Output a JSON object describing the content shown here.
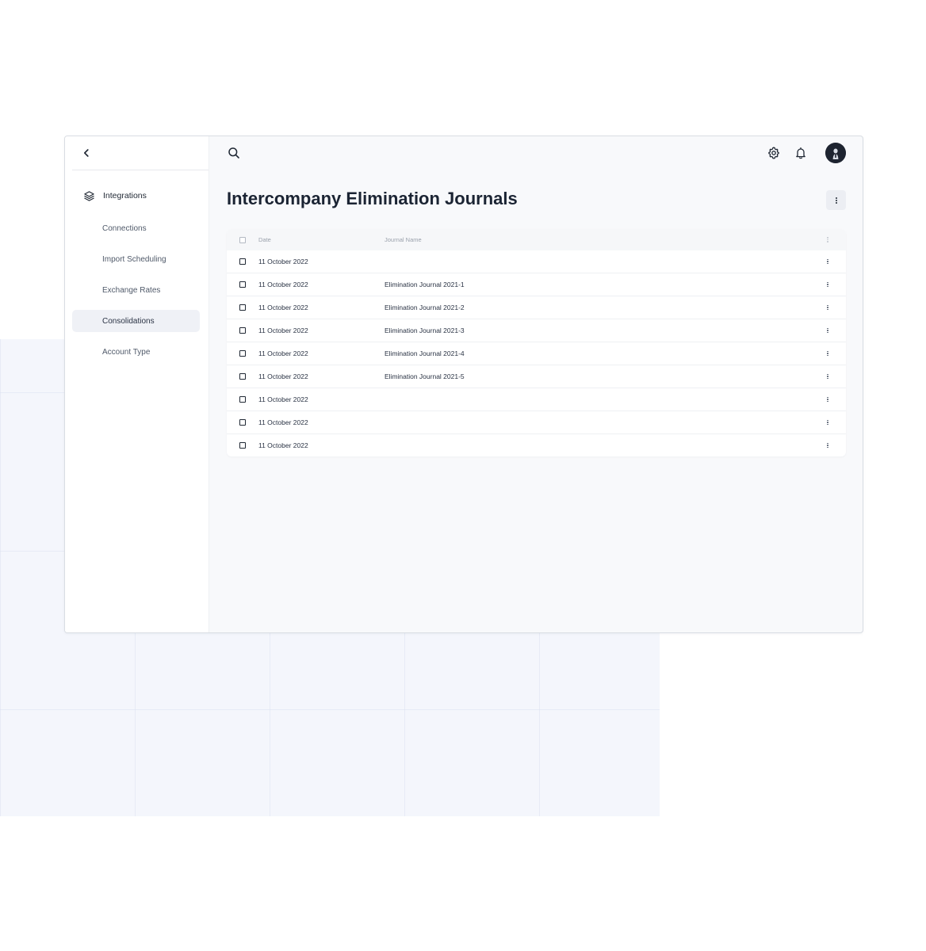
{
  "sidebar": {
    "back_icon": "chevron-left-icon",
    "section": {
      "icon": "layers-icon",
      "label": "Integrations"
    },
    "items": [
      {
        "label": "Connections",
        "active": false
      },
      {
        "label": "Import Scheduling",
        "active": false
      },
      {
        "label": "Exchange Rates",
        "active": false
      },
      {
        "label": "Consolidations",
        "active": true
      },
      {
        "label": "Account Type",
        "active": false
      }
    ]
  },
  "topbar": {
    "search_icon": "search-icon",
    "settings_icon": "gear-icon",
    "notifications_icon": "bell-icon",
    "avatar_icon": "user-avatar"
  },
  "page": {
    "title": "Intercompany Elimination Journals",
    "menu_icon": "kebab-menu-icon"
  },
  "table": {
    "columns": {
      "date": "Date",
      "journal_name": "Journal Name"
    },
    "rows": [
      {
        "date": "11 October 2022",
        "journal_name": ""
      },
      {
        "date": "11 October 2022",
        "journal_name": "Elimination Journal 2021-1"
      },
      {
        "date": "11 October 2022",
        "journal_name": "Elimination Journal 2021-2"
      },
      {
        "date": "11 October 2022",
        "journal_name": "Elimination Journal 2021-3"
      },
      {
        "date": "11 October 2022",
        "journal_name": "Elimination Journal 2021-4"
      },
      {
        "date": "11 October 2022",
        "journal_name": "Elimination Journal 2021-5"
      },
      {
        "date": "11 October 2022",
        "journal_name": ""
      },
      {
        "date": "11 October 2022",
        "journal_name": ""
      },
      {
        "date": "11 October 2022",
        "journal_name": ""
      }
    ]
  },
  "colors": {
    "window_bg": "#f8f9fb",
    "sidebar_bg": "#ffffff",
    "active_item_bg": "#eff1f6",
    "text_primary": "#1f2733",
    "text_muted": "#9aa1ac",
    "avatar_bg": "#1e2430",
    "backdrop_grid": "#f4f6fc"
  }
}
